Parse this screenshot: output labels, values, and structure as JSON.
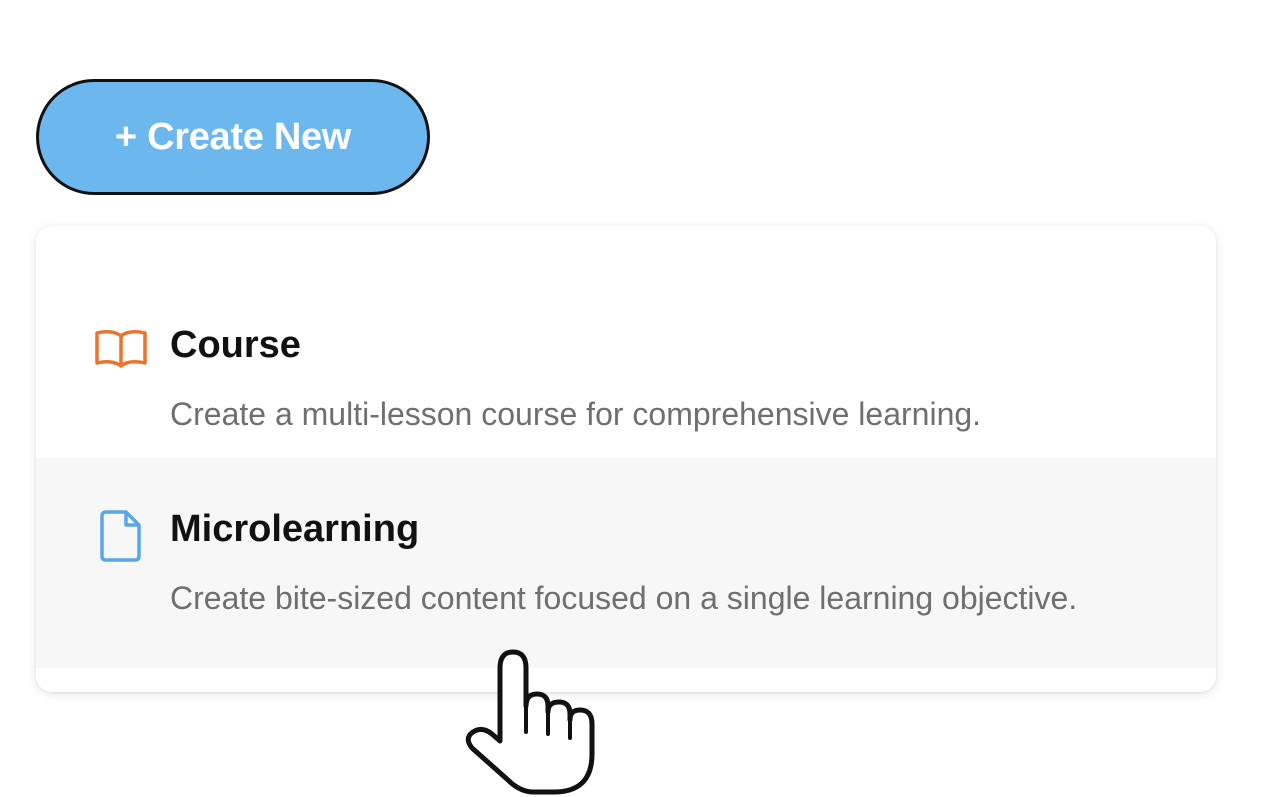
{
  "create_button": {
    "label": "+ Create New",
    "color": "#6bb7ee"
  },
  "menu": {
    "items": [
      {
        "title": "Course",
        "description": "Create a multi-lesson course for comprehensive learning.",
        "icon": "book-open-icon",
        "icon_color": "#e8742e"
      },
      {
        "title": "Microlearning",
        "description": "Create bite-sized content focused on a single learning objective.",
        "icon": "document-icon",
        "icon_color": "#5aa6ea"
      }
    ]
  },
  "cursor": {
    "icon": "hand-pointer-icon"
  }
}
